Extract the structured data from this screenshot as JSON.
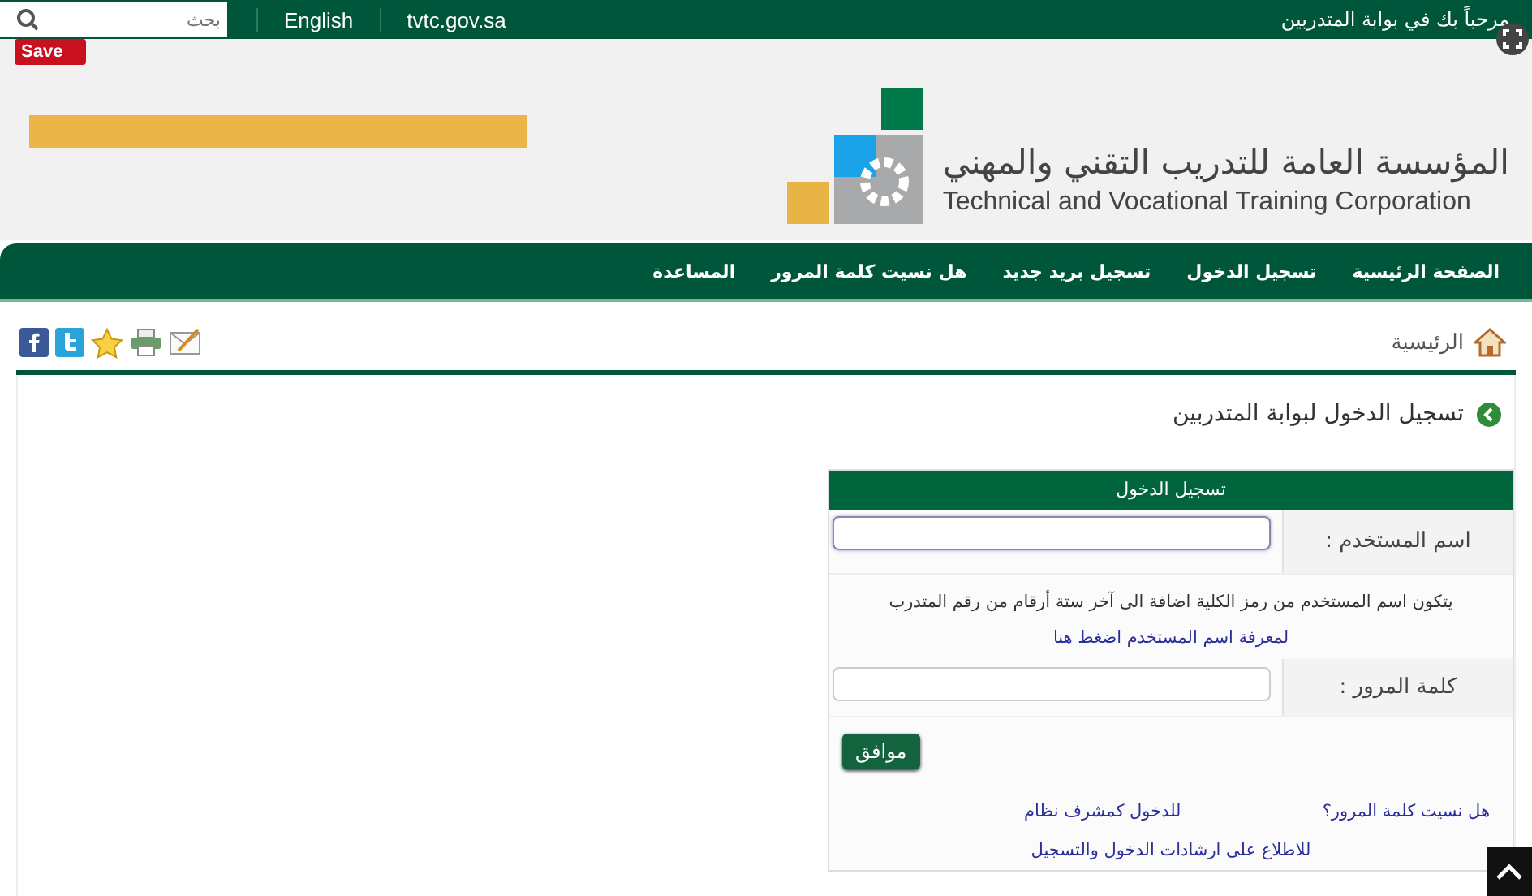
{
  "top_bar": {
    "search": {
      "placeholder": "بحث"
    },
    "links": [
      "tvtc.gov.sa",
      "English"
    ],
    "welcome": "مرحباً بك في بوابة المتدربين"
  },
  "overlay": {
    "save_label": "Save"
  },
  "header": {
    "title_ar": "المؤسسة العامة للتدريب التقني والمهني",
    "title_en": "Technical and Vocational Training Corporation"
  },
  "nav": {
    "items": [
      "الصفحة الرئيسية",
      "تسجيل الدخول",
      "تسجيل بريد جديد",
      "هل نسيت كلمة المرور",
      "المساعدة"
    ]
  },
  "breadcrumb": "الرئيسية",
  "page_title": "تسجيل الدخول لبوابة المتدربين",
  "login": {
    "title": "تسجيل الدخول",
    "username_label": "اسم المستخدم :",
    "hint": "يتكون اسم المستخدم من رمز الكلية اضافة الى آخر ستة أرقام من رقم المتدرب",
    "hint_link": "لمعرفة اسم المستخدم اضغط هنا",
    "password_label": "كلمة المرور :",
    "submit": "موافق",
    "links": [
      "هل نسيت كلمة المرور؟",
      "للدخول كمشرف نظام"
    ],
    "bottom_link": "للاطلاع على ارشادات الدخول والتسجيل"
  }
}
